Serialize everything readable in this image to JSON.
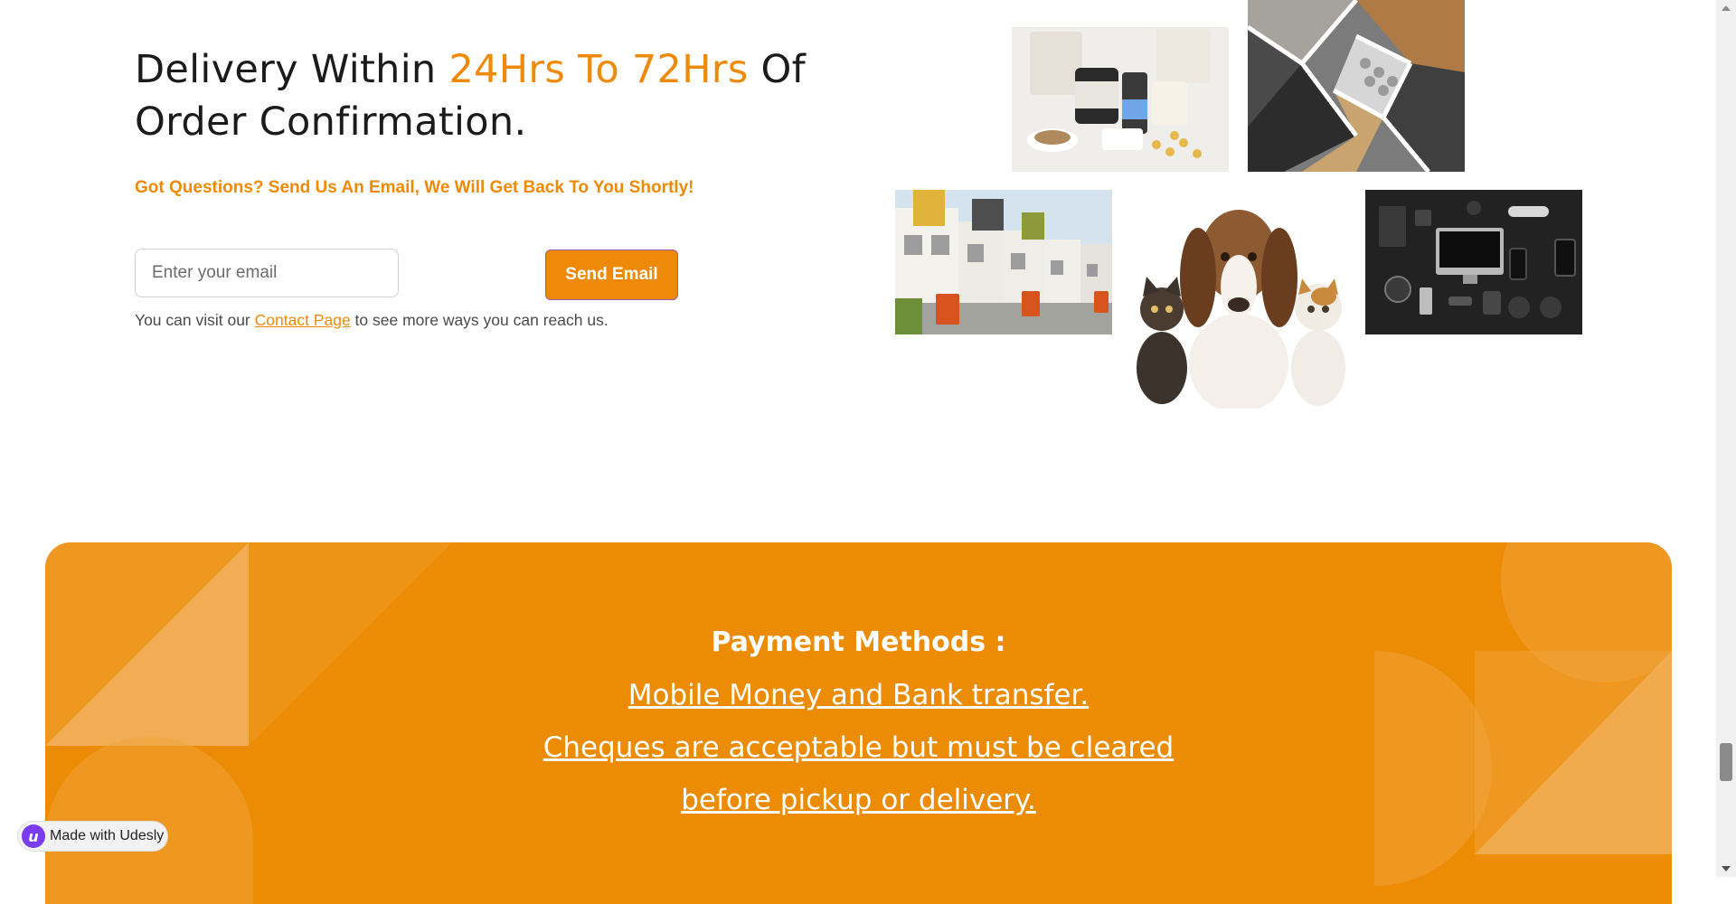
{
  "hero": {
    "title_before": "Delivery Within ",
    "title_accent": "24Hrs To 72Hrs",
    "title_after": " Of Order Confirmation.",
    "subtitle": "Got Questions? Send Us An Email, We Will Get Back To You Shortly!",
    "email_placeholder": "Enter your email",
    "send_button": "Send Email",
    "contact_prefix": "You can visit our ",
    "contact_link": "Contact Page",
    "contact_suffix": " to see more ways you can reach us."
  },
  "payment": {
    "title": "Payment Methods :",
    "lines": [
      "Mobile Money and Bank transfer.",
      "Cheques are acceptable but must be cleared",
      "before  pickup or delivery."
    ]
  },
  "badge": {
    "logo_letter": "u",
    "label": "Made with Udesly"
  },
  "colors": {
    "accent": "#ee8a07",
    "banner": "#ec8b04",
    "badge_logo": "#7a3cf0"
  }
}
